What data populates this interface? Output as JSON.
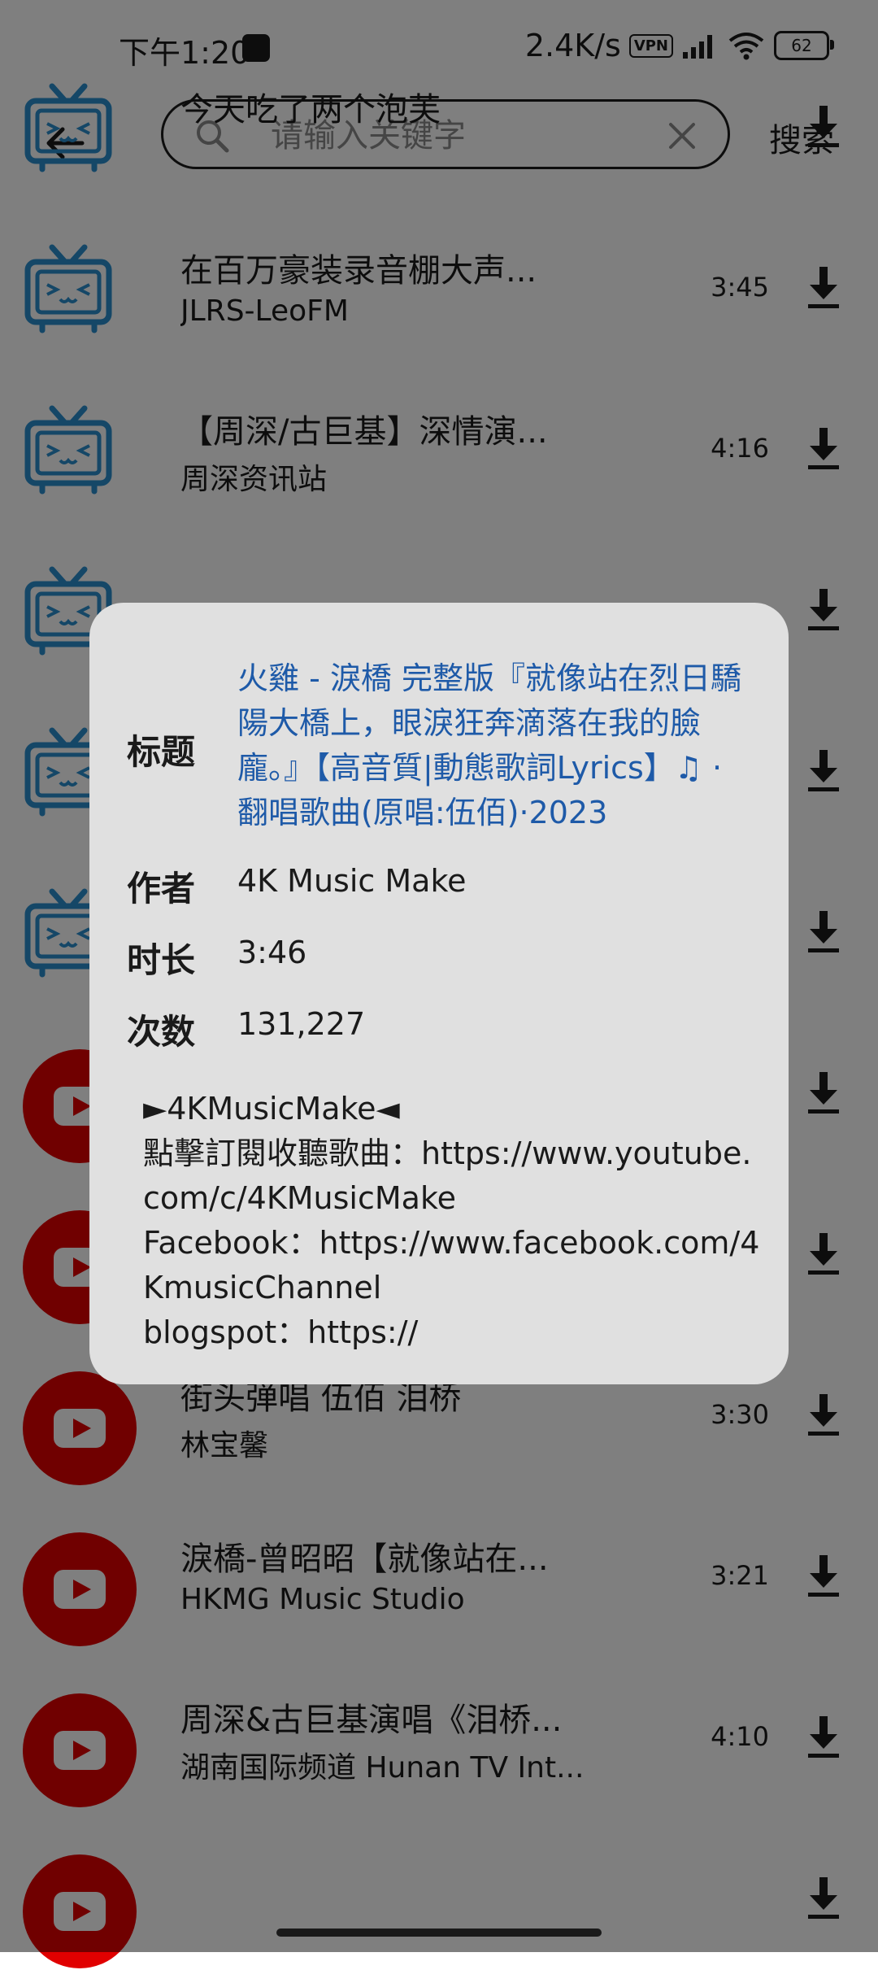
{
  "status_bar": {
    "time": "下午1:20",
    "net_speed": "2.4K/s",
    "vpn": "VPN",
    "battery": "62"
  },
  "search": {
    "placeholder": "请输入关键字",
    "value": "",
    "button_label": "搜索"
  },
  "results": [
    {
      "type": "bilibili",
      "title": "今天吃了两个泡芙",
      "author": "",
      "duration": ""
    },
    {
      "type": "bilibili",
      "title": "在百万豪装录音棚大声...",
      "author": "JLRS-LeoFM",
      "duration": "3:45"
    },
    {
      "type": "bilibili",
      "title": "【周深/古巨基】深情演...",
      "author": "周深资讯站",
      "duration": "4:16"
    },
    {
      "type": "bilibili",
      "title": "",
      "author": "",
      "duration": ""
    },
    {
      "type": "bilibili",
      "title": "",
      "author": "",
      "duration": ""
    },
    {
      "type": "bilibili",
      "title": "",
      "author": "",
      "duration": ""
    },
    {
      "type": "youtube",
      "title": "",
      "author": "",
      "duration": ""
    },
    {
      "type": "youtube",
      "title": "",
      "author": "",
      "duration": ""
    },
    {
      "type": "youtube",
      "title": "街头弹唱 伍佰 泪桥",
      "author": "林宝馨",
      "duration": "3:30"
    },
    {
      "type": "youtube",
      "title": "淚橋-曾昭昭【就像站在...",
      "author": "HKMG Music Studio",
      "duration": "3:21"
    },
    {
      "type": "youtube",
      "title": "周深&古巨基演唱《泪桥...",
      "author": "湖南国际频道 Hunan TV Int...",
      "duration": "4:10"
    },
    {
      "type": "youtube",
      "title": "",
      "author": "",
      "duration": ""
    }
  ],
  "detail": {
    "title_label": "标题",
    "title": "火雞 - 淚橋 完整版『就像站在烈日驕陽大橋上，眼淚狂奔滴落在我的臉龐。』【高音質|動態歌詞Lyrics】♫ · 翻唱歌曲(原唱:伍佰)·2023",
    "author_label": "作者",
    "author": "4K Music Make",
    "duration_label": "时长",
    "duration": "3:46",
    "views_label": "次数",
    "views": "131,227",
    "description": "►4KMusicMake◄\n點擊訂閱收聽歌曲：https://www.youtube.com/c/4KMusicMake\nFacebook：https://www.facebook.com/4KmusicChannel\nblogspot：https://"
  },
  "colors": {
    "link_blue": "#1e5aa8",
    "bilibili_blue": "#2a8fcf",
    "youtube_red": "#e00000",
    "dialog_bg": "#e0e0e0"
  }
}
